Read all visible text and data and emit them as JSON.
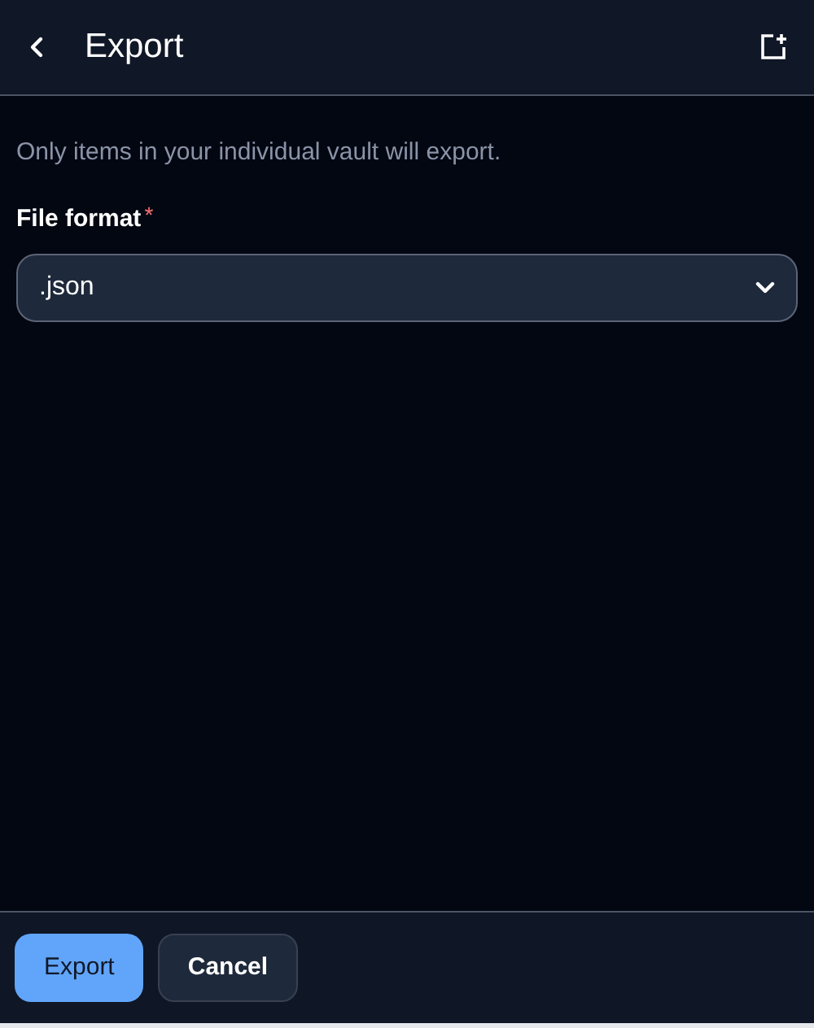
{
  "header": {
    "title": "Export"
  },
  "notice": "Only items in your individual vault will export.",
  "file_format": {
    "label": "File format",
    "required_mark": "*",
    "value": ".json"
  },
  "buttons": [
    {
      "label": "Export",
      "kind": "primary"
    },
    {
      "label": "Cancel",
      "kind": "secondary"
    }
  ]
}
